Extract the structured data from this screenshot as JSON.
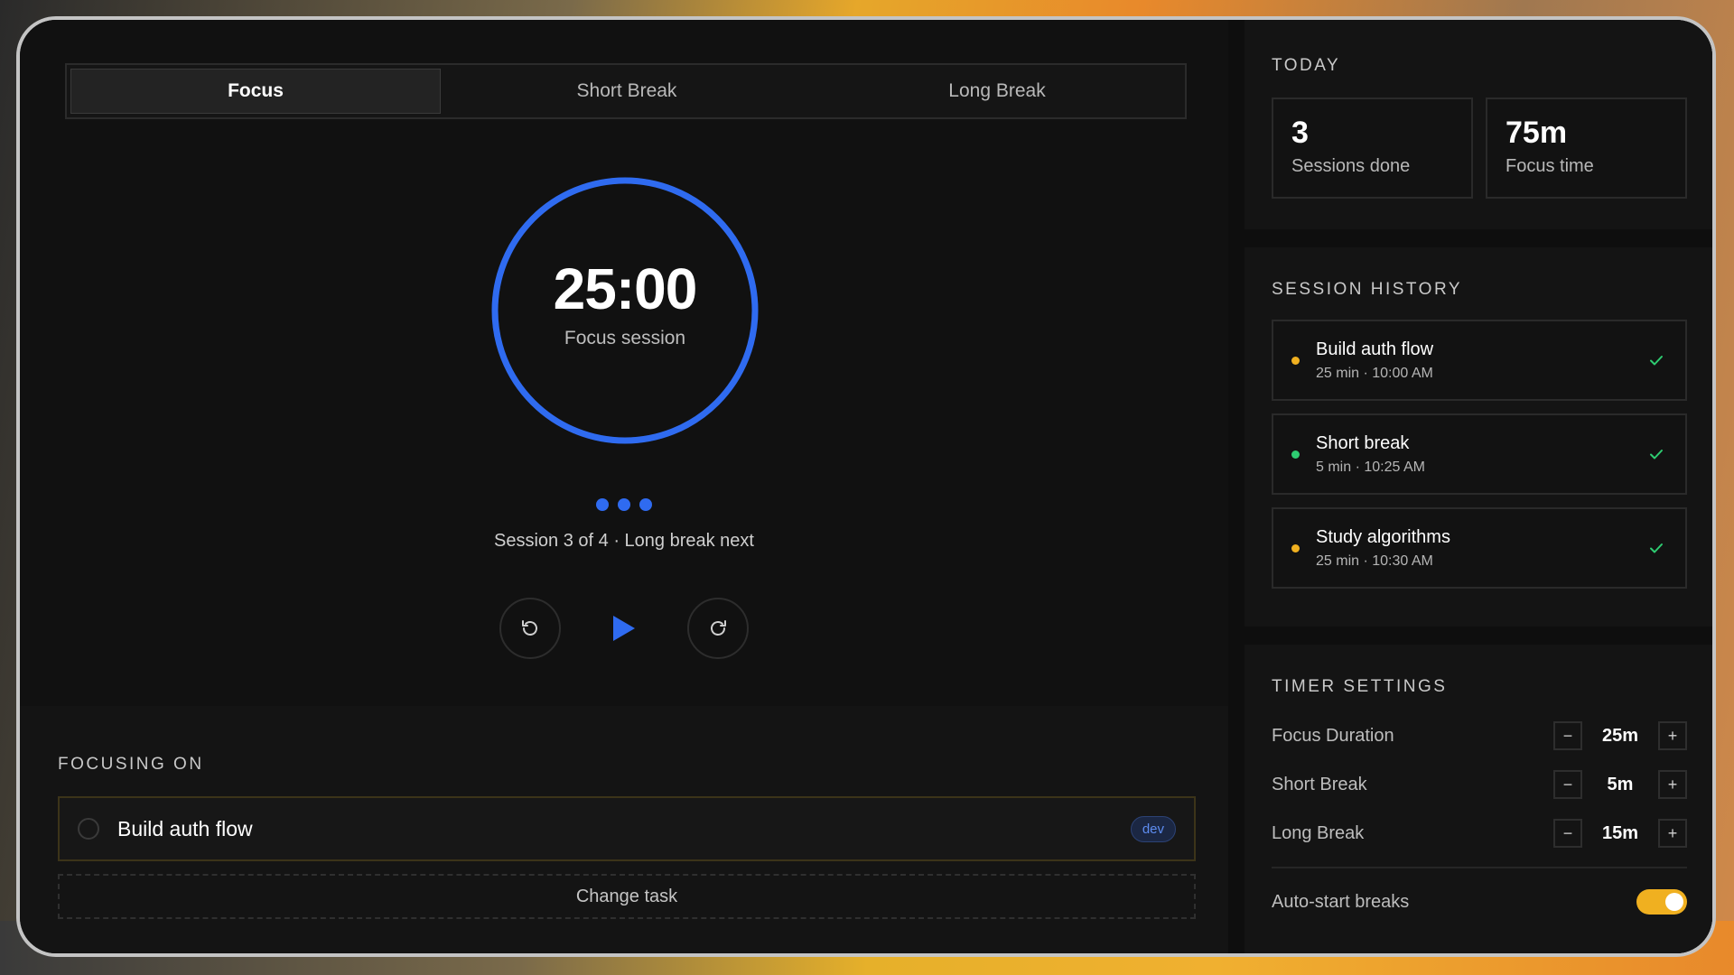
{
  "tabs": [
    {
      "label": "Focus"
    },
    {
      "label": "Short Break"
    },
    {
      "label": "Long Break"
    }
  ],
  "timer": {
    "time": "25:00",
    "subtitle": "Focus session",
    "progress": 1.0,
    "session_info": "Session 3 of 4 · Long break next",
    "dots_count": 3
  },
  "focusing": {
    "section_title": "FOCUSING ON",
    "task_name": "Build auth flow",
    "badge": "dev",
    "change_label": "Change task"
  },
  "today": {
    "title": "TODAY",
    "stats": [
      {
        "value": "3",
        "label": "Sessions done"
      },
      {
        "value": "75m",
        "label": "Focus time"
      }
    ]
  },
  "history": {
    "title": "SESSION HISTORY",
    "items": [
      {
        "title": "Build auth flow",
        "meta": "25 min · 10:00 AM",
        "color": "#f0b020"
      },
      {
        "title": "Short break",
        "meta": "5 min · 10:25 AM",
        "color": "#2ecc71"
      },
      {
        "title": "Study algorithms",
        "meta": "25 min · 10:30 AM",
        "color": "#f0b020"
      }
    ]
  },
  "settings": {
    "title": "TIMER SETTINGS",
    "rows": [
      {
        "label": "Focus Duration",
        "value": "25m"
      },
      {
        "label": "Short Break",
        "value": "5m"
      },
      {
        "label": "Long Break",
        "value": "15m"
      }
    ],
    "minus": "−",
    "plus": "+",
    "auto_start_label": "Auto-start breaks",
    "auto_start_on": true
  },
  "colors": {
    "accent": "#2f6bf0",
    "toggle": "#f0b020",
    "check": "#2ecc71"
  },
  "icons": {
    "reset": "reset-icon",
    "play": "play-icon",
    "skip": "skip-icon",
    "check": "check-icon"
  }
}
